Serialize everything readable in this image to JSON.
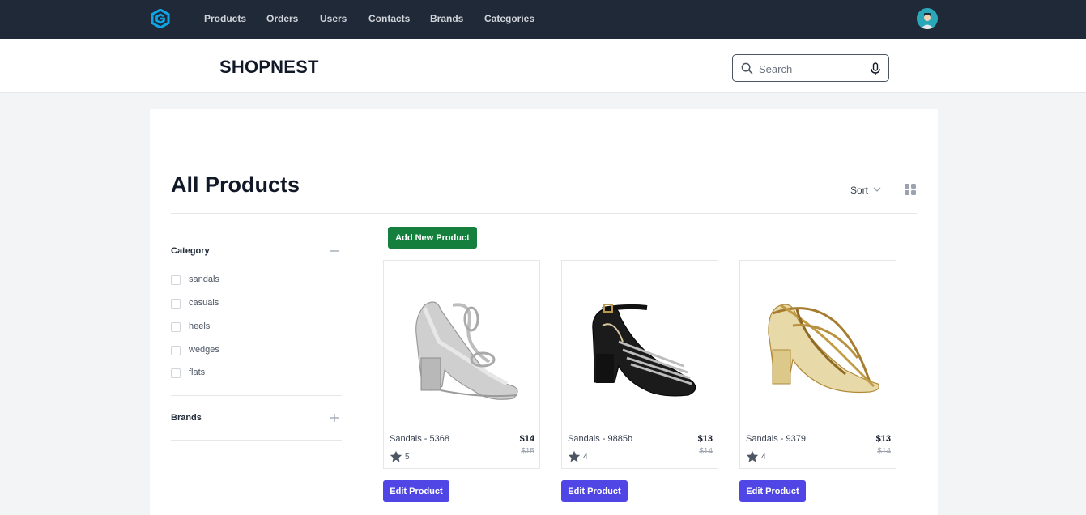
{
  "nav": {
    "logo": "brand-logo",
    "links": [
      "Products",
      "Orders",
      "Users",
      "Contacts",
      "Brands",
      "Categories"
    ],
    "avatar": "user-avatar"
  },
  "header": {
    "brand": "SHOPNEST",
    "search": {
      "placeholder": "Search",
      "value": ""
    }
  },
  "main": {
    "title": "All Products",
    "sort_label": "Sort",
    "add_button": "Add New Product",
    "edit_button": "Edit Product"
  },
  "filters": {
    "category": {
      "label": "Category",
      "expanded": true,
      "options": [
        "sandals",
        "casuals",
        "heels",
        "wedges",
        "flats"
      ]
    },
    "brands": {
      "label": "Brands",
      "expanded": false
    }
  },
  "products": [
    {
      "name": "Sandals - 5368",
      "price": "$14",
      "old_price": "$15",
      "rating": "5",
      "color": "silver"
    },
    {
      "name": "Sandals - 9885b",
      "price": "$13",
      "old_price": "$14",
      "rating": "4",
      "color": "black"
    },
    {
      "name": "Sandals - 9379",
      "price": "$13",
      "old_price": "$14",
      "rating": "4",
      "color": "gold"
    }
  ],
  "colors": {
    "nav_bg": "#1f2937",
    "add_button": "#15803d",
    "edit_button": "#4f46e5",
    "logo": "#0ea5e9"
  }
}
